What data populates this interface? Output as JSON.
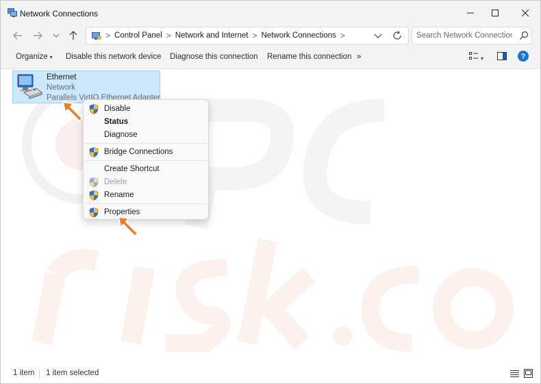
{
  "window": {
    "title": "Network Connections",
    "app_icon": "network-connections-icon"
  },
  "window_controls": {
    "minimize": "minimize-icon",
    "maximize": "maximize-icon",
    "close": "close-icon"
  },
  "nav": {
    "back_icon": "arrow-left-icon",
    "forward_icon": "arrow-right-icon",
    "recent_icon": "chevron-down-icon",
    "up_icon": "arrow-up-icon"
  },
  "address": {
    "location_icon": "control-panel-icon",
    "breadcrumbs": [
      "Control Panel",
      "Network and Internet",
      "Network Connections"
    ],
    "separator": ">",
    "dropdown_icon": "chevron-down-icon",
    "refresh_icon": "refresh-icon"
  },
  "search": {
    "placeholder": "Search Network Connections",
    "value": "",
    "icon": "search-icon"
  },
  "commandbar": {
    "organize": "Organize",
    "organize_caret": "▾",
    "disable": "Disable this network device",
    "diagnose": "Diagnose this connection",
    "rename": "Rename this connection",
    "more": "»",
    "view_icon": "view-options-icon",
    "view_caret": "▾",
    "preview_pane_icon": "preview-pane-icon",
    "help_icon": "help-icon",
    "help_glyph": "?"
  },
  "connection": {
    "name": "Ethernet",
    "status": "Network",
    "device": "Parallels VirtIO Ethernet Adapter",
    "icon": "ethernet-adapter-icon"
  },
  "context_menu": {
    "items": [
      {
        "label": "Disable",
        "icon": "uac-shield-icon"
      },
      {
        "label": "Status",
        "bold": true
      },
      {
        "label": "Diagnose"
      },
      {
        "label": "Bridge Connections",
        "icon": "uac-shield-icon"
      },
      {
        "label": "Create Shortcut"
      },
      {
        "label": "Delete",
        "icon": "uac-shield-icon",
        "disabled": true
      },
      {
        "label": "Rename",
        "icon": "uac-shield-icon"
      },
      {
        "label": "Properties",
        "icon": "uac-shield-icon"
      }
    ]
  },
  "annotations": {
    "arrow_color": "#f07d28"
  },
  "statusbar": {
    "item_count": "1 item",
    "selected": "1 item selected",
    "details_view_icon": "details-view-icon",
    "tiles_view_icon": "large-icons-view-icon"
  },
  "colors": {
    "chrome_bg": "#f3f3f3",
    "selection_bg": "#cce8ff",
    "selection_border": "#99d1ff",
    "help_blue": "#1976d2"
  }
}
